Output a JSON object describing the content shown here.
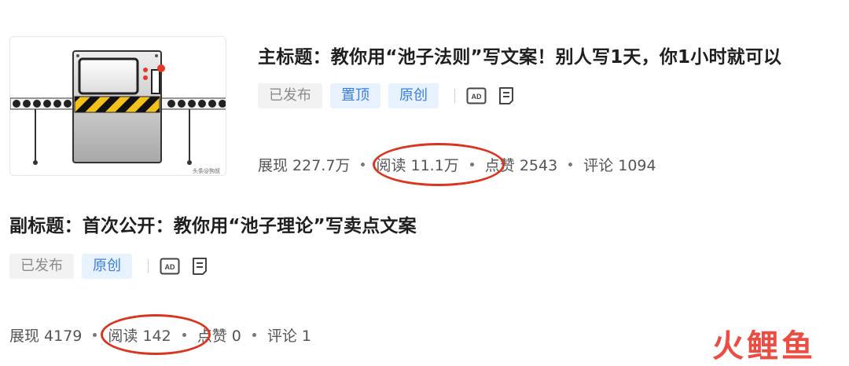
{
  "articles": [
    {
      "title": "主标题：教你用“池子法则”写文案！别人写1天，你1小时就可以",
      "tags": [
        {
          "label": "已发布",
          "style": "gray"
        },
        {
          "label": "置顶",
          "style": "blue"
        },
        {
          "label": "原创",
          "style": "blue"
        }
      ],
      "icons": [
        "ad-icon",
        "document-list-icon"
      ],
      "stats": {
        "impressions": "展现 227.7万",
        "reads": "阅读 11.1万",
        "likes": "点赞 2543",
        "comments": "评论 1094"
      },
      "thumbnail_watermark": "头条@狗叔"
    },
    {
      "title": "副标题：首次公开：教你用“池子理论”写卖点文案",
      "tags": [
        {
          "label": "已发布",
          "style": "gray"
        },
        {
          "label": "原创",
          "style": "blue"
        }
      ],
      "icons": [
        "ad-icon",
        "document-list-icon"
      ],
      "stats": {
        "impressions": "展现 4179",
        "reads": "阅读 142",
        "likes": "点赞 0",
        "comments": "评论 1"
      }
    }
  ],
  "icon_labels": {
    "ad": "AD"
  },
  "brand": {
    "text": "火鲤鱼",
    "color": "#ec4d43"
  },
  "highlight_color": "#d9361f"
}
